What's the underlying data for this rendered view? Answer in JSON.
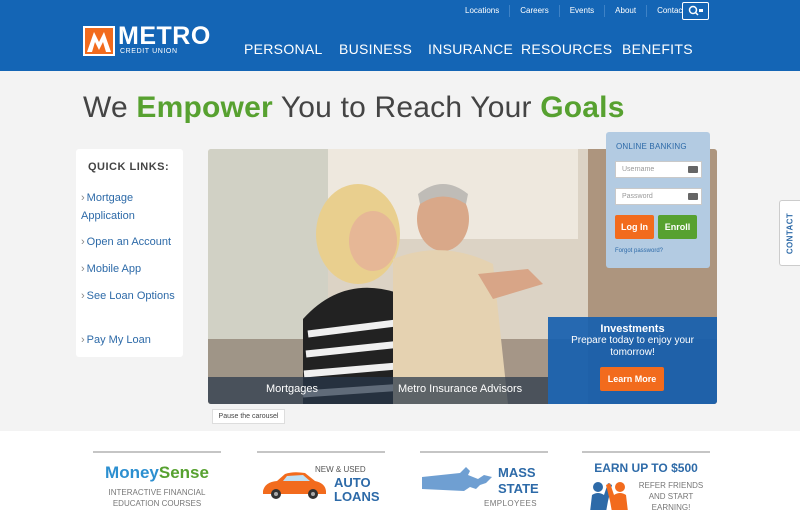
{
  "brand": {
    "name": "METRO",
    "subtitle": "CREDIT UNION",
    "orange": "#f26b1d",
    "blue": "#1465b5",
    "green": "#57a130"
  },
  "utility_nav": [
    "Locations",
    "Careers",
    "Events",
    "About",
    "Contact"
  ],
  "search_icon": "search-icon",
  "main_nav": [
    "PERSONAL",
    "BUSINESS",
    "INSURANCE",
    "RESOURCES",
    "BENEFITS"
  ],
  "headline": {
    "part1": "We ",
    "em1": "Empower",
    "part2": " You to Reach Your ",
    "em2": "Goals"
  },
  "quick_links": {
    "title": "QUICK LINKS:",
    "items": [
      "Mortgage Application",
      "Open an Account",
      "Mobile App",
      "See Loan Options",
      "Pay My Loan"
    ]
  },
  "carousel": {
    "tabs": [
      "Mortgages",
      "Metro Insurance Advisors"
    ],
    "feature": {
      "title": "Investments",
      "subtitle": "Prepare today to enjoy your tomorrow!",
      "button": "Learn More"
    },
    "pause_label": "Pause the carousel"
  },
  "online_banking": {
    "title": "ONLINE BANKING",
    "username_placeholder": "Username",
    "password_placeholder": "Password",
    "login_label": "Log In",
    "enroll_label": "Enroll",
    "forgot_label": "Forgot password?"
  },
  "contact_tab": "CONTACT",
  "promos": {
    "moneysense": {
      "title_a": "Money",
      "title_b": "Sense",
      "sub": "INTERACTIVE FINANCIAL EDUCATION COURSES"
    },
    "auto": {
      "top": "NEW & USED",
      "line1": "AUTO",
      "line2": "LOANS"
    },
    "mass_state": {
      "line1": "MASS",
      "line2": "STATE",
      "sub": "EMPLOYEES"
    },
    "earn": {
      "title": "EARN UP TO $500",
      "sub": "REFER FRIENDS AND START EARNING!"
    }
  }
}
